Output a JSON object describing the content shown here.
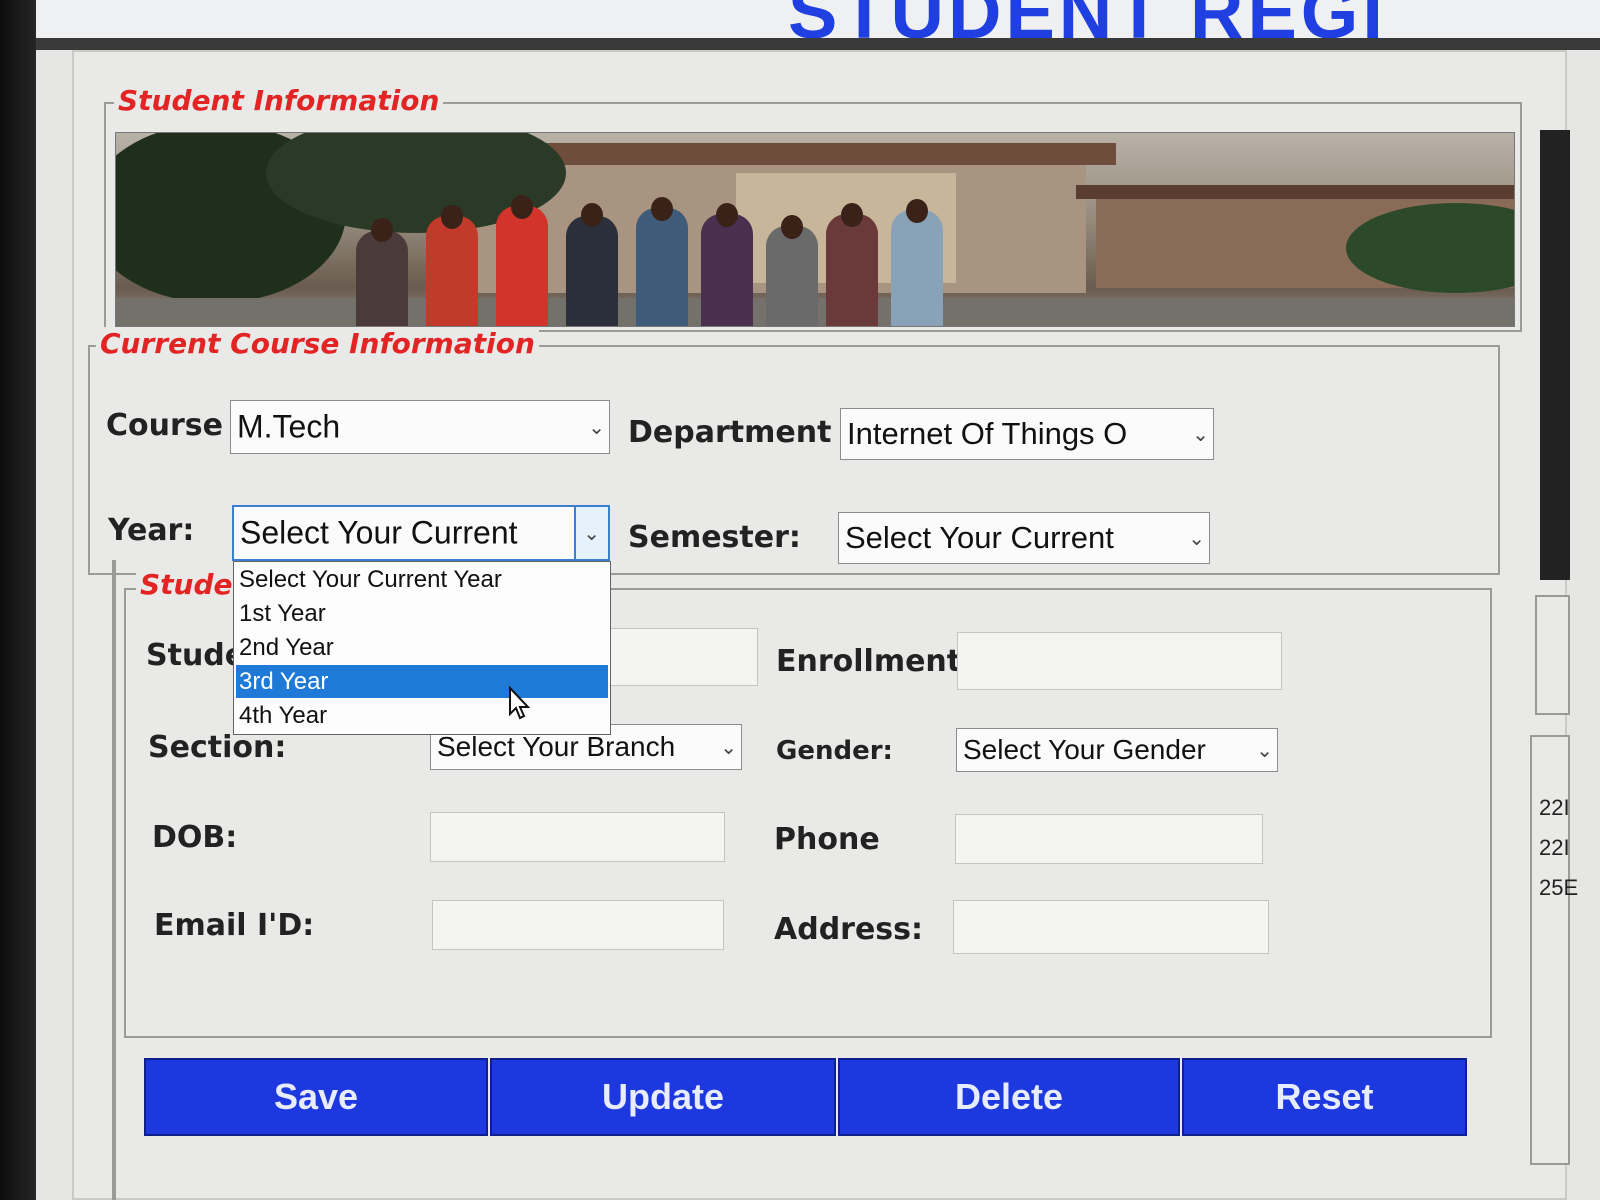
{
  "app": {
    "title": "STUDENT REGI"
  },
  "groups": {
    "student_information": "Student Information",
    "current_course": "Current Course Information",
    "student_details": "Stude"
  },
  "course": {
    "course_label": "Course",
    "course_value": "M.Tech",
    "department_label": "Department",
    "department_value": "Internet Of Things O",
    "year_label": "Year:",
    "year_value": "Select Your Current",
    "semester_label": "Semester:",
    "semester_value": "Select Your Current"
  },
  "year_dropdown": {
    "options": [
      "Select Your Current Year",
      "1st Year",
      "2nd Year",
      "3rd Year",
      "4th Year"
    ],
    "highlighted": "3rd Year"
  },
  "details": {
    "student_label": "Stude",
    "enrollment_label": "Enrollment",
    "section_label": "Section:",
    "section_value": "Select Your Branch",
    "gender_label": "Gender:",
    "gender_value": "Select Your Gender",
    "dob_label": "DOB:",
    "phone_label": "Phone",
    "email_label": "Email I'D:",
    "address_label": "Address:"
  },
  "buttons": {
    "save": "Save",
    "update": "Update",
    "delete": "Delete",
    "reset": "Reset"
  },
  "right_panel": {
    "rows": [
      "22I",
      "22I",
      "25E"
    ]
  },
  "colors": {
    "title_blue": "#1f3fe0",
    "group_title_red": "#e32424",
    "button_blue": "#1e38e0",
    "selection_blue": "#1e7ad6"
  },
  "icons": {
    "combo_arrow": "chevron-down-icon",
    "cursor": "mouse-pointer-icon"
  }
}
